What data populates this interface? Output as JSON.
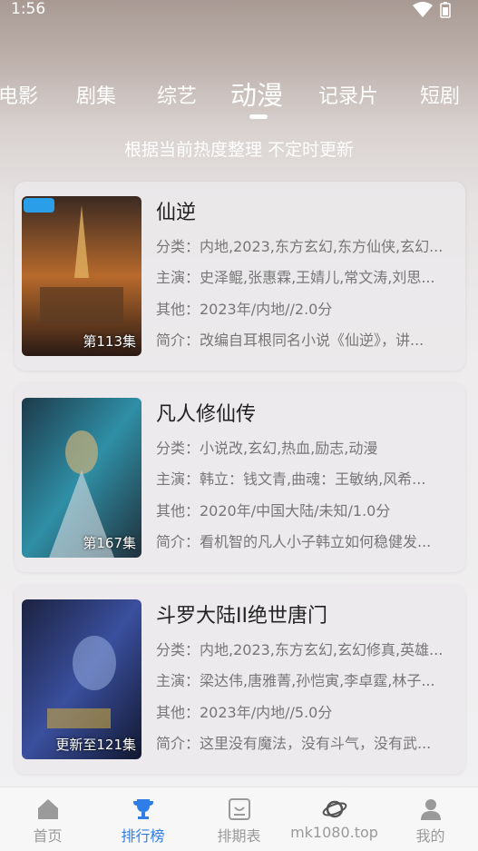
{
  "status_bar": {
    "time": "1:56"
  },
  "tabs": [
    {
      "label": "电影"
    },
    {
      "label": "剧集"
    },
    {
      "label": "综艺"
    },
    {
      "label": "动漫",
      "active": true
    },
    {
      "label": "记录片"
    },
    {
      "label": "短剧"
    }
  ],
  "subtitle": "根据当前热度整理 不定时更新",
  "cards": [
    {
      "title": "仙逆",
      "category": "分类：内地,2023,东方玄幻,东方仙侠,玄幻...",
      "cast": "主演：史泽鲲,张惠霖,王婧儿,常文涛,刘思...",
      "other": "其他：2023年/内地//2.0分",
      "intro": "简介：改编自耳根同名小说《仙逆》，讲...",
      "badge": "第113集",
      "poster_colors": [
        "#3b2a22",
        "#b86a2c",
        "#e0b060"
      ]
    },
    {
      "title": "凡人修仙传",
      "category": "分类：小说改,玄幻,热血,励志,动漫",
      "cast": "主演：韩立：钱文青,曲魂：王敏纳,风希...",
      "other": "其他：2020年/中国大陆/未知/1.0分",
      "intro": "简介：看机智的凡人小子韩立如何稳健发...",
      "badge": "第167集",
      "poster_colors": [
        "#1d3a4a",
        "#2f8fa6",
        "#c7b07a"
      ]
    },
    {
      "title": "斗罗大陆II绝世唐门",
      "category": "分类：内地,2023,东方玄幻,玄幻修真,英雄...",
      "cast": "主演：梁达伟,唐雅菁,孙恺寅,李卓霆,林子...",
      "other": "其他：2023年/内地//5.0分",
      "intro": "简介：这里没有魔法，没有斗气，没有武...",
      "badge": "更新至121集",
      "poster_colors": [
        "#1c2240",
        "#3a4f9e",
        "#9fb6e6"
      ]
    }
  ],
  "bottom_nav": [
    {
      "label": "首页",
      "icon": "home-icon"
    },
    {
      "label": "排行榜",
      "icon": "trophy-icon",
      "active": true
    },
    {
      "label": "排期表",
      "icon": "schedule-icon"
    },
    {
      "label": "mk1080.top",
      "icon": "planet-icon"
    },
    {
      "label": "我的",
      "icon": "user-icon"
    }
  ],
  "colors": {
    "accent": "#2f7ee8",
    "inactive": "#9a9a9a"
  }
}
